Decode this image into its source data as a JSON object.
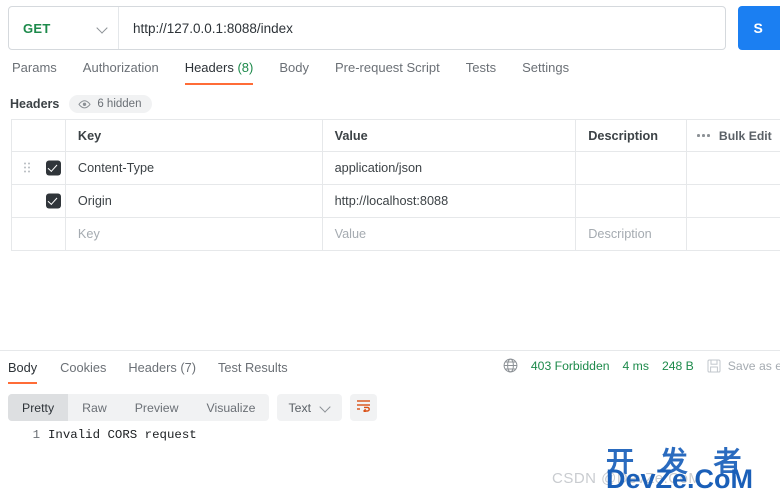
{
  "request": {
    "method": "GET",
    "url": "http://127.0.0.1:8088/index",
    "send_label": "S",
    "send_color": "#1b7ff2",
    "tabs": [
      {
        "label": "Params",
        "active": false
      },
      {
        "label": "Authorization",
        "active": false
      },
      {
        "label": "Headers",
        "count": "(8)",
        "active": true
      },
      {
        "label": "Body",
        "active": false
      },
      {
        "label": "Pre-request Script",
        "active": false
      },
      {
        "label": "Tests",
        "active": false
      },
      {
        "label": "Settings",
        "active": false
      }
    ]
  },
  "headers_section": {
    "title": "Headers",
    "hidden_badge": "6 hidden",
    "hidden_icon": "eye-icon",
    "columns": [
      "Key",
      "Value",
      "Description"
    ],
    "bulk_edit_label": "Bulk Edit",
    "more_icon": "ellipsis-icon",
    "rows": [
      {
        "checked": true,
        "key": "Content-Type",
        "value": "application/json",
        "description": ""
      },
      {
        "checked": true,
        "key": "Origin",
        "value": "http://localhost:8088",
        "description": ""
      }
    ],
    "new_row": {
      "key_placeholder": "Key",
      "value_placeholder": "Value",
      "description_placeholder": "Description"
    }
  },
  "response": {
    "tabs": [
      {
        "label": "Body",
        "active": true
      },
      {
        "label": "Cookies",
        "active": false
      },
      {
        "label": "Headers (7)",
        "active": false
      },
      {
        "label": "Test Results",
        "active": false
      }
    ],
    "status": {
      "globe_icon": "globe-icon",
      "code": "403 Forbidden",
      "status_color": "#1d8a4b",
      "time": "4 ms",
      "size": "248 B",
      "save_icon": "floppy-save-icon",
      "save_label": "Save as e"
    },
    "format": {
      "segments": [
        {
          "label": "Pretty",
          "active": true
        },
        {
          "label": "Raw",
          "active": false
        },
        {
          "label": "Preview",
          "active": false
        },
        {
          "label": "Visualize",
          "active": false
        }
      ],
      "type_select": "Text",
      "type_chevron": "chevron-down-icon",
      "wrap_icon": "word-wrap-icon",
      "wrap_color": "#d94f14"
    },
    "body": {
      "line_number": "1",
      "text": "Invalid CORS request"
    }
  },
  "watermarks": {
    "csdn": "CSDN @DevZe.CoM",
    "cn_title": "开 发 者",
    "site": "DevZe.CoM",
    "color": "#1a5fb8"
  }
}
